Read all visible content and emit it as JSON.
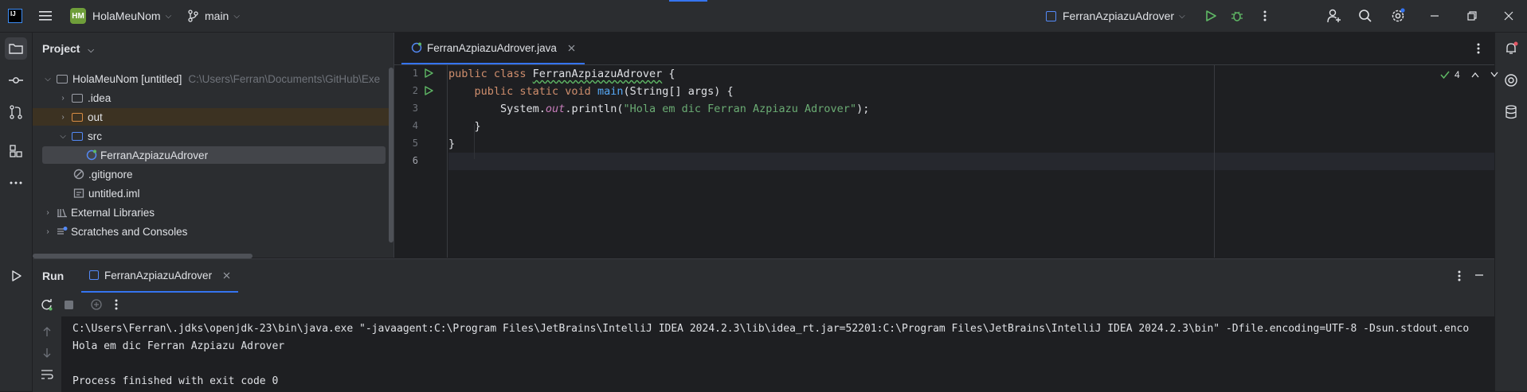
{
  "titlebar": {
    "app_logo": "IJ",
    "project_badge": "HM",
    "project_name": "HolaMeuNom",
    "branch": "main",
    "run_config": "FerranAzpiazuAdrover",
    "icons": [
      "menu-icon",
      "branch-icon",
      "run-icon",
      "debug-icon",
      "more-icon",
      "add-user-icon",
      "search-icon",
      "settings-icon",
      "minimize-icon",
      "restore-icon",
      "close-icon"
    ]
  },
  "project_panel": {
    "title": "Project",
    "tree": [
      {
        "label": "HolaMeuNom [untitled]",
        "hint": "C:\\Users\\Ferran\\Documents\\GitHub\\Exe",
        "type": "module",
        "expanded": true
      },
      {
        "label": ".idea",
        "type": "folder"
      },
      {
        "label": "out",
        "type": "folder-excluded"
      },
      {
        "label": "src",
        "type": "folder-source",
        "expanded": true
      },
      {
        "label": "FerranAzpiazuAdrover",
        "type": "java-class",
        "selected": true
      },
      {
        "label": ".gitignore",
        "type": "ignore-file"
      },
      {
        "label": "untitled.iml",
        "type": "iml-file"
      },
      {
        "label": "External Libraries",
        "type": "libraries"
      },
      {
        "label": "Scratches and Consoles",
        "type": "scratches"
      }
    ]
  },
  "editor": {
    "tab_label": "FerranAzpiazuAdrover.java",
    "line_numbers": [
      "1",
      "2",
      "3",
      "4",
      "5",
      "6"
    ],
    "code": {
      "l1_kw": "public class ",
      "l1_name": "FerranAzpiazuAdrover",
      "l1_rest": " {",
      "l2_indent": "    ",
      "l2_kw": "public static void ",
      "l2_fn": "main",
      "l2_rest": "(String[] args) {",
      "l3_a": "        System.",
      "l3_out": "out",
      "l3_b": ".println(",
      "l3_str": "\"Hola em dic Ferran Azpiazu Adrover\"",
      "l3_c": ");",
      "l4": "    }",
      "l5": "}",
      "l6": ""
    },
    "inspection_count": "4"
  },
  "run_panel": {
    "title": "Run",
    "tab_label": "FerranAzpiazuAdrover",
    "console": [
      "C:\\Users\\Ferran\\.jdks\\openjdk-23\\bin\\java.exe \"-javaagent:C:\\Program Files\\JetBrains\\IntelliJ IDEA 2024.2.3\\lib\\idea_rt.jar=52201:C:\\Program Files\\JetBrains\\IntelliJ IDEA 2024.2.3\\bin\" -Dfile.encoding=UTF-8 -Dsun.stdout.enco",
      "Hola em dic Ferran Azpiazu Adrover",
      "",
      "Process finished with exit code 0"
    ]
  },
  "colors": {
    "accent": "#3574f0",
    "run_green": "#5fb865",
    "keyword": "#cf8e6d",
    "string": "#6aab73",
    "function": "#56a8f5"
  }
}
